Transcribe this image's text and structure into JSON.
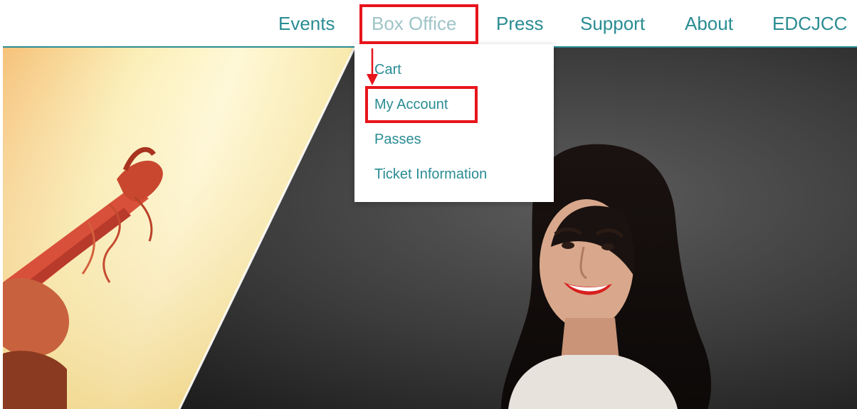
{
  "nav": {
    "items": [
      {
        "label": "Events"
      },
      {
        "label": "Box Office",
        "active": true
      },
      {
        "label": "Press"
      },
      {
        "label": "Support"
      },
      {
        "label": "About"
      },
      {
        "label": "EDCJCC"
      }
    ]
  },
  "dropdown": {
    "items": [
      {
        "label": "Cart"
      },
      {
        "label": "My Account"
      },
      {
        "label": "Passes"
      },
      {
        "label": "Ticket Information"
      }
    ]
  },
  "colors": {
    "brand_teal": "#2a8c93",
    "active_nav": "#9fc4c8",
    "annotation_red": "#e8141b"
  },
  "annotations": {
    "highlighted": [
      "Box Office",
      "My Account"
    ],
    "arrow": "Box Office to My Account"
  },
  "hero": {
    "left_panel": "violin scroll on warm yellow background",
    "right_panel": "smiling woman with dark wavy hair on dark gray background"
  }
}
